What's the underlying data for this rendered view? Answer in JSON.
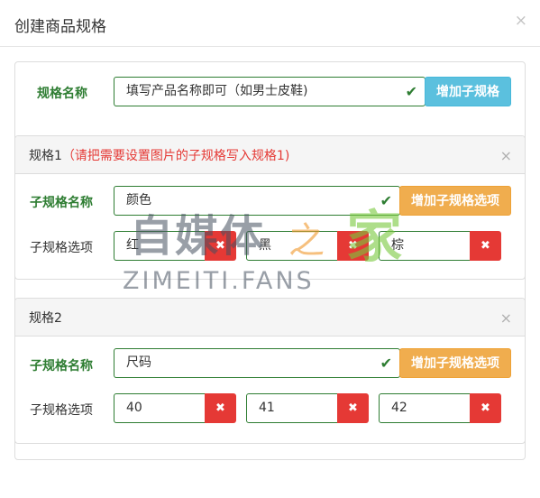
{
  "modal": {
    "title": "创建商品规格",
    "close_icon": "×"
  },
  "spec": {
    "label": "规格名称",
    "value": "填写产品名称即可（如男士皮鞋)",
    "add_sub_button": "增加子规格"
  },
  "sub_specs": [
    {
      "title": "规格1",
      "hint": "（请把需要设置图片的子规格写入规格1)",
      "name_label": "子规格名称",
      "name_value": "颜色",
      "add_option_button": "增加子规格选项",
      "options_label": "子规格选项",
      "options": [
        "红",
        "黑",
        "棕"
      ]
    },
    {
      "title": "规格2",
      "hint": "",
      "name_label": "子规格名称",
      "name_value": "尺码",
      "add_option_button": "增加子规格选项",
      "options_label": "子规格选项",
      "options": [
        "40",
        "41",
        "42"
      ]
    }
  ],
  "icons": {
    "check": "✔",
    "delete": "✖",
    "close": "×"
  },
  "watermark": {
    "cn_text": "自媒体",
    "zhi": "之",
    "jia": "家",
    "en_text": "ZIMEITI.FANS"
  },
  "colors": {
    "success": "#2e7d32",
    "info": "#5bc0de",
    "warning": "#f0ad4e",
    "danger": "#e53935",
    "hint": "#e53935"
  }
}
